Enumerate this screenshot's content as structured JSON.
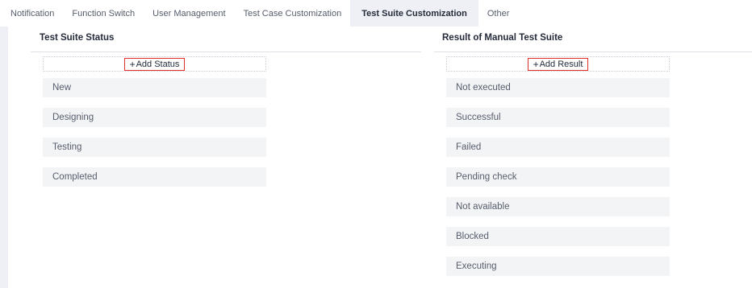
{
  "tabs": [
    {
      "label": "Notification"
    },
    {
      "label": "Function Switch"
    },
    {
      "label": "User Management"
    },
    {
      "label": "Test Case Customization"
    },
    {
      "label": "Test Suite Customization",
      "active": true
    },
    {
      "label": "Other"
    }
  ],
  "colors": {
    "active_tab_bg": "#eef0f5",
    "item_bg": "#f3f4f6",
    "highlight_border": "#e0302e"
  },
  "status_section": {
    "title": "Test Suite Status",
    "add_label": "Add Status",
    "plus_icon": "+",
    "items": [
      "New",
      "Designing",
      "Testing",
      "Completed"
    ]
  },
  "result_section": {
    "title": "Result of Manual Test Suite",
    "add_label": "Add Result",
    "plus_icon": "+",
    "items": [
      "Not executed",
      "Successful",
      "Failed",
      "Pending check",
      "Not available",
      "Blocked",
      "Executing"
    ]
  }
}
